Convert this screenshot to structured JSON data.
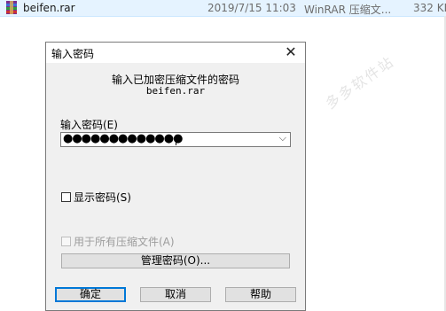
{
  "file_row": {
    "name": "beifen.rar",
    "date": "2019/7/15 11:03",
    "type": "WinRAR 压缩文...",
    "size": "332 KB"
  },
  "watermark": "多多软件站",
  "dialog": {
    "title": "输入密码",
    "heading": "输入已加密压缩文件的密码",
    "archive_name": "beifen.rar",
    "password_label": "输入密码(E)",
    "password_value": "●●●●●●●●●●●●●",
    "show_password_label": "显示密码(S)",
    "use_for_all_label": "用于所有压缩文件(A)",
    "manage_button": "管理密码(O)...",
    "ok_button": "确定",
    "cancel_button": "取消",
    "help_button": "帮助"
  }
}
